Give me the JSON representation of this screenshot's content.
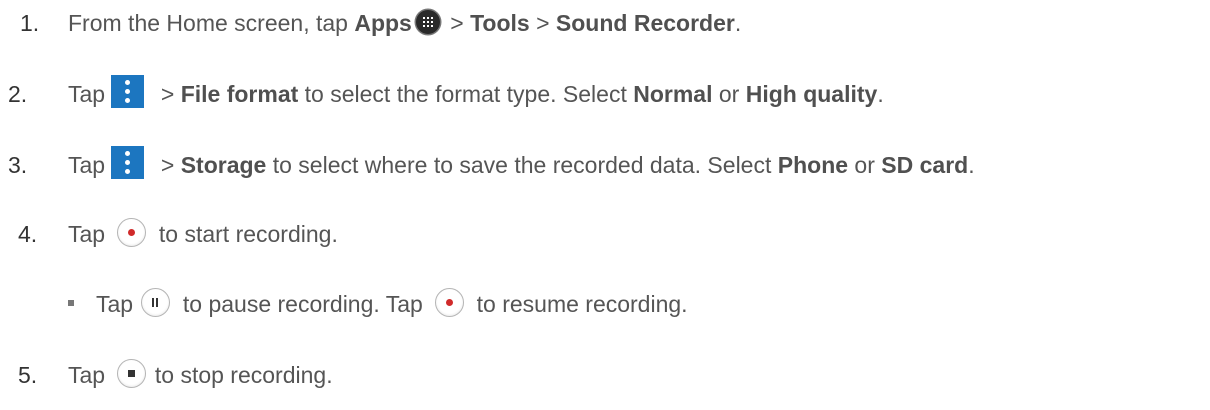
{
  "steps": [
    {
      "number": "1.",
      "t1": "From the Home screen, tap ",
      "b1": "Apps",
      "icon": "apps-grid-icon",
      "t2": " > ",
      "b2": "Tools",
      "t3": " > ",
      "b3": "Sound Recorder",
      "t4": "."
    },
    {
      "number": "2.",
      "t1": "Tap ",
      "icon": "menu-more-icon",
      "t2": " > ",
      "b1": "File format",
      "t3": " to select the format type. Select ",
      "b2": "Normal",
      "t4": " or ",
      "b3": "High quality",
      "t5": "."
    },
    {
      "number": "3.",
      "t1": "Tap ",
      "icon": "menu-more-icon",
      "t2": " > ",
      "b1": "Storage",
      "t3": " to select where to save the recorded data. Select ",
      "b2": "Phone",
      "t4": " or ",
      "b3": "SD card",
      "t5": "."
    },
    {
      "number": "4.",
      "t1": "Tap ",
      "icon": "record-icon",
      "t2": " to start recording."
    },
    {
      "number": "5.",
      "t1": "Tap ",
      "icon": "stop-icon",
      "t2": " to stop recording."
    }
  ],
  "sub_step": {
    "t1": "Tap ",
    "icon1": "pause-icon",
    "t2": " to pause recording. Tap ",
    "icon2": "record-icon",
    "t3": " to resume recording."
  },
  "colors": {
    "menu_icon_bg": "#1c76c0",
    "record_dot": "#d02a2a",
    "apps_icon_bg": "#2a2a2a"
  }
}
